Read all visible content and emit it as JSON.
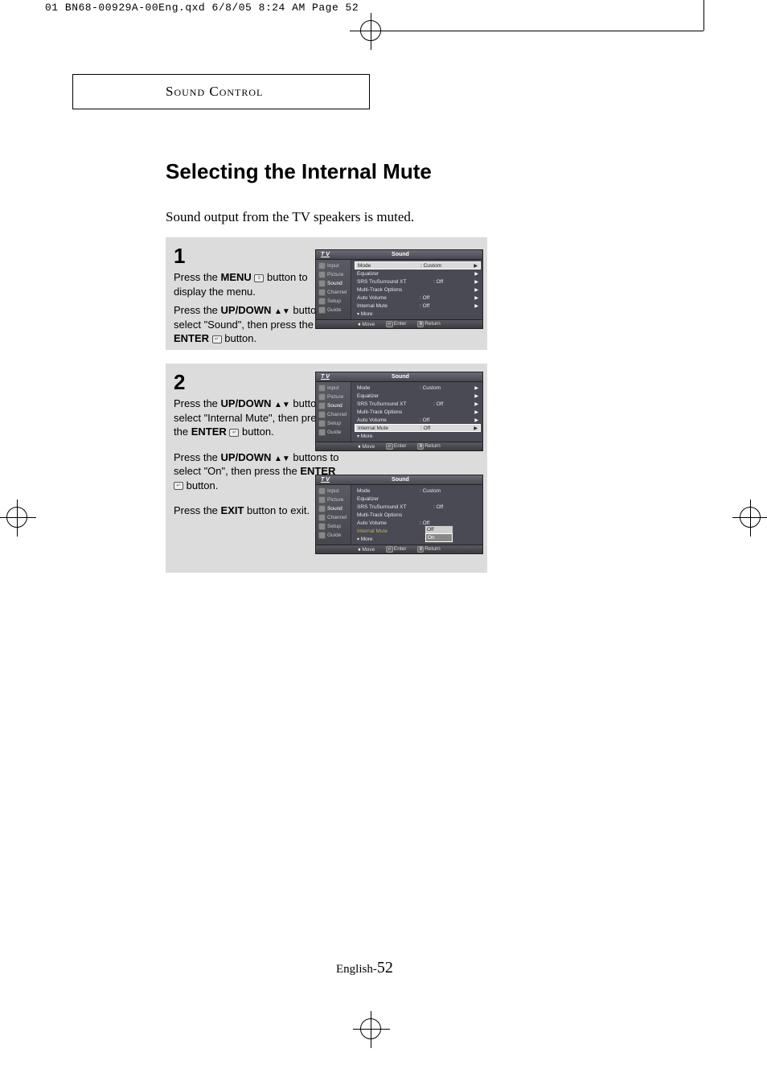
{
  "print_header": "01 BN68-00929A-00Eng.qxd  6/8/05 8:24 AM  Page 52",
  "section_heading": "Sound Control",
  "title": "Selecting the Internal Mute",
  "intro": "Sound output from the TV speakers is muted.",
  "step1": {
    "num": "1",
    "line1a": "Press the ",
    "line1b": "MENU",
    "line1c": " button to display the menu.",
    "line2a": "Press the ",
    "line2b": "UP/DOWN",
    "line2c": " buttons to select \"Sound\", then press the ",
    "line2d": "ENTER",
    "line2e": " button."
  },
  "step2": {
    "num": "2",
    "p1a": "Press the ",
    "p1b": "UP/DOWN",
    "p1c": " buttons to select \"Internal Mute\", then press the ",
    "p1d": "ENTER",
    "p1e": " button.",
    "p2a": "Press the ",
    "p2b": "UP/DOWN",
    "p2c": " buttons to select \"On\", then press the ",
    "p2d": "ENTER",
    "p2e": " button.",
    "p3a": "Press the ",
    "p3b": "EXIT",
    "p3c": " button to exit."
  },
  "osd": {
    "tv": "T V",
    "title": "Sound",
    "side": [
      "Input",
      "Picture",
      "Sound",
      "Channel",
      "Setup",
      "Guide"
    ],
    "rows": {
      "mode": {
        "label": "Mode",
        "val": ": Custom"
      },
      "eq": {
        "label": "Equalizer",
        "val": ""
      },
      "srs": {
        "label": "SRS TruSurround XT",
        "val": ": Off"
      },
      "mto": {
        "label": "Multi-Track Options",
        "val": ""
      },
      "av": {
        "label": "Auto Volume",
        "val": ": Off"
      },
      "im": {
        "label": "Internal Mute",
        "val": ": Off"
      },
      "more": {
        "label": "More",
        "val": ""
      }
    },
    "dropdown": {
      "off": "Off",
      "on": "On"
    },
    "footer": {
      "move": "Move",
      "enter": "Enter",
      "return": "Return"
    }
  },
  "page_label": "English-",
  "page_num": "52"
}
